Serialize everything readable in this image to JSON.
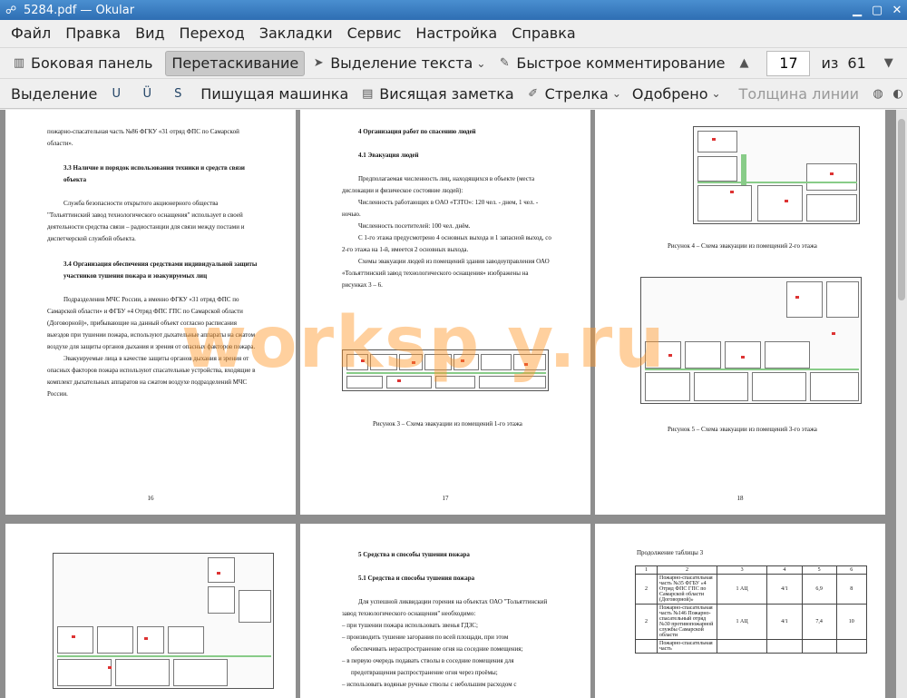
{
  "window": {
    "title": "5284.pdf — Okular"
  },
  "menu": [
    "Файл",
    "Правка",
    "Вид",
    "Переход",
    "Закладки",
    "Сервис",
    "Настройка",
    "Справка"
  ],
  "toolbar": {
    "sidebar": "Боковая панель",
    "drag": "Перетаскивание",
    "text_select": "Выделение текста",
    "quick_comment": "Быстрое комментирование",
    "page_current": "17",
    "page_of": "из",
    "page_total": "61"
  },
  "annot_toolbar": {
    "highlight": "Выделение",
    "typewriter": "Пишущая машинка",
    "popup_note": "Висящая заметка",
    "arrow": "Стрелка",
    "approved": "Одобрено",
    "line_width": "Толщина линии"
  },
  "watermark": "worksp y.ru",
  "pages": {
    "p16": {
      "lines": [
        "пожарно-спасательная часть №86 ФГКУ «31 отряд ФПС по Самарской",
        "области».",
        "3.3 Наличие и порядок использования техники и средств связи",
        "объекта",
        "Служба безопасности открытого акционерного общества",
        "\"Тольяттинский завод технологического оснащения\" использует в своей",
        "деятельности средства связи – радиостанции для связи между постами и",
        "диспетчерской службой объекта.",
        "3.4 Организация обеспечения средствами индивидуальной защиты",
        "участников тушения пожара и эвакуируемых лиц",
        "Подразделения МЧС России, а именно ФГКУ «31 отряд ФПС по",
        "Самарской области» и ФГБУ «4 Отряд ФПС ГПС по Самарской области",
        "(Договорной)», прибывающие на данный объект согласно расписания",
        "выездов при тушении пожара, используют дыхательные аппараты на сжатом",
        "воздухе для защиты органов дыхания и зрения от опасных факторов пожара.",
        "Эвакуируемые лица в качестве защиты органов дыхания и зрения от",
        "опасных факторов пожара используют спасательные устройства, входящие в",
        "комплект дыхательных аппаратов на сжатом воздухе подразделений МЧС",
        "России."
      ],
      "num": "16"
    },
    "p17": {
      "lines": [
        "4 Организация работ по спасению людей",
        "4.1 Эвакуация людей",
        "Предполагаемая численность лиц, находящихся в объекте (места",
        "дислокации и физическое состояние людей):",
        "Численность работающих в ОАО «ТЗТО»: 120 чел. - днем, 1 чел. -",
        "ночью.",
        "Численность посетителей: 100 чел. днём.",
        "С 1-го этажа предусмотрено 4 основных выхода и 1 запасной выход, со",
        "2-го этажа на 1-й, имеется 2 основных выхода.",
        "Схемы эвакуации людей из помещений здания заводоуправления ОАО",
        "«Тольяттинский завод технологического оснащения» изображены на",
        "рисунках 3 – 6."
      ],
      "caption": "Рисунок 3 – Схема эвакуации из помещений 1-го этажа",
      "num": "17"
    },
    "p18": {
      "caption4": "Рисунок 4 – Схема эвакуации из помещений 2-го этажа",
      "caption5": "Рисунок 5 – Схема эвакуации из помещений 3-го этажа",
      "num": "18"
    },
    "p20": {
      "lines": [
        "5 Средства и способы тушения пожара",
        "5.1 Средства и способы тушения пожара",
        "Для успешной ликвидации горения на объектах ОАО \"Тольяттинский",
        "завод технологического оснащения\" необходимо:",
        "– при тушении пожара использовать звенья ГДЗС;",
        "– производить тушение загорания по всей площади, при этом",
        "обеспечивать нераспространение огня на соседние помещения;",
        "– в первую очередь подавать стволы в соседние помещения для",
        "предотвращения распространение огня через проёмы;",
        "– использовать водяные ручные стволы с небольшим расходом с"
      ]
    },
    "p21": {
      "title": "Продолжение таблицы 3",
      "header": [
        "1",
        "2",
        "3",
        "4",
        "5",
        "6"
      ],
      "rows": [
        {
          "c1": "2",
          "c2": "Пожарно-спасательная часть №35 ФГБУ «4 Отряд ФПС ГПС по Самарской области (Договорной)»",
          "c3": "1 АЦ",
          "c4": "4/1",
          "c5": "6,9",
          "c6": "8"
        },
        {
          "c1": "2",
          "c2": "Пожарно-спасательная часть №146 Пожарно-спасательный отряд №30 противопожарной службы Самарской области",
          "c3": "1 АЦ",
          "c4": "4/1",
          "c5": "7,4",
          "c6": "10"
        },
        {
          "c2": "Пожарно-спасательная часть"
        }
      ]
    }
  },
  "colors": {
    "titlebar": "#2e6eb3",
    "viewer_bg": "#8e8e8e",
    "watermark": "#ff9628"
  }
}
